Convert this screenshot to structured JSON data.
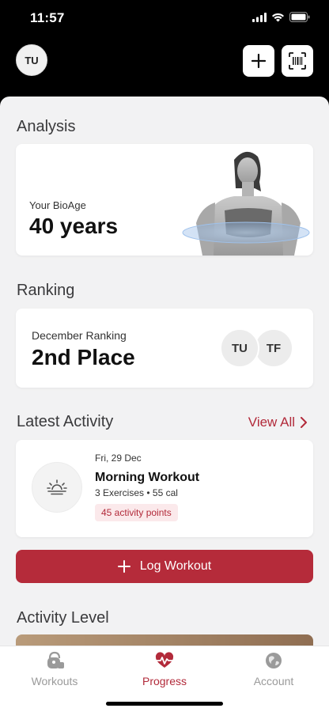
{
  "status": {
    "time": "11:57"
  },
  "header": {
    "avatar_initials": "TU",
    "add_icon": "plus-icon",
    "scan_icon": "barcode-scan-icon"
  },
  "analysis": {
    "title": "Analysis",
    "bio_label": "Your BioAge",
    "bio_value": "40 years"
  },
  "ranking": {
    "title": "Ranking",
    "label": "December Ranking",
    "value": "2nd Place",
    "avatars": [
      "TU",
      "TF"
    ]
  },
  "activity": {
    "title": "Latest Activity",
    "view_all": "View All",
    "date": "Fri, 29 Dec",
    "name": "Morning Workout",
    "meta": "3 Exercises • 55 cal",
    "points": "45 activity points",
    "icon": "sunrise-icon"
  },
  "log_workout": {
    "label": "Log Workout"
  },
  "activity_level": {
    "title": "Activity Level"
  },
  "tabs": [
    {
      "label": "Workouts",
      "icon": "kettlebell-icon",
      "active": false
    },
    {
      "label": "Progress",
      "icon": "heartbeat-icon",
      "active": true
    },
    {
      "label": "Account",
      "icon": "globe-icon",
      "active": false
    }
  ],
  "colors": {
    "accent": "#b22a3a",
    "button": "#b52b3a",
    "badge_bg": "#fbe9eb"
  }
}
